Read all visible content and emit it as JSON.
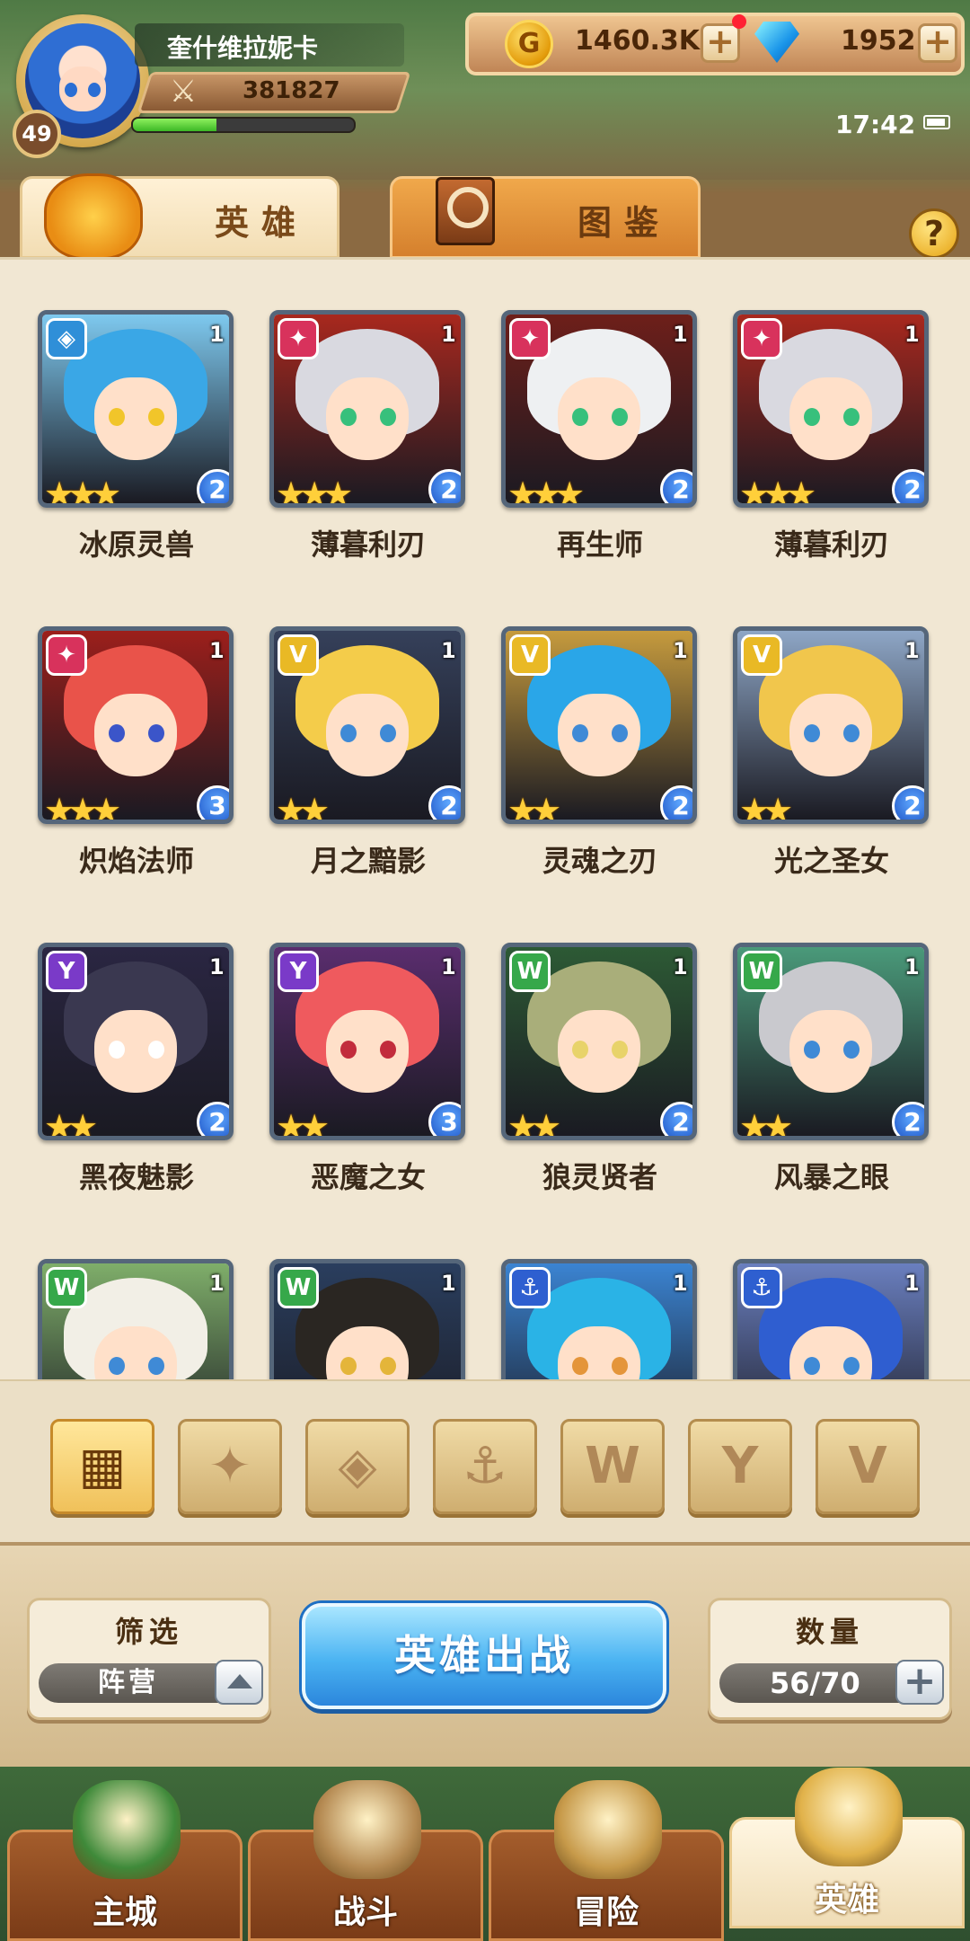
{
  "player": {
    "name": "奎什维拉妮卡",
    "level": "49",
    "power": "381827",
    "exp_fraction": 0.38
  },
  "resources": {
    "gold": "1460.3K",
    "gems": "1952"
  },
  "status": {
    "time": "17:42"
  },
  "tabs": [
    {
      "label": "英雄",
      "active": true
    },
    {
      "label": "图鉴",
      "active": false
    }
  ],
  "help_label": "?",
  "heroes": [
    {
      "name": "冰原灵兽",
      "level": "1",
      "stars": "★★★",
      "rank": "2",
      "faction": "ice",
      "faction_color": "#2f8fd8",
      "faction_glyph": "◈",
      "bg": "#7ec9ef",
      "hair": "#3aa7e6",
      "eye": "#f1c52a"
    },
    {
      "name": "薄暮利刃",
      "level": "1",
      "stars": "★★★",
      "rank": "2",
      "faction": "fire",
      "faction_color": "#d8325c",
      "faction_glyph": "✦",
      "bg": "#a8281e",
      "hair": "#d9d9e0",
      "eye": "#37c07c"
    },
    {
      "name": "再生师",
      "level": "1",
      "stars": "★★★",
      "rank": "2",
      "faction": "fire",
      "faction_color": "#d8325c",
      "faction_glyph": "✦",
      "bg": "#6e1f1a",
      "hair": "#eef0f2",
      "eye": "#37c07c"
    },
    {
      "name": "薄暮利刃",
      "level": "1",
      "stars": "★★★",
      "rank": "2",
      "faction": "fire",
      "faction_color": "#d8325c",
      "faction_glyph": "✦",
      "bg": "#a8281e",
      "hair": "#d9d9e0",
      "eye": "#37c07c"
    },
    {
      "name": "炽焰法师",
      "level": "1",
      "stars": "★★★",
      "rank": "3",
      "faction": "fire",
      "faction_color": "#d8325c",
      "faction_glyph": "✦",
      "bg": "#9c1f1b",
      "hair": "#e9534a",
      "eye": "#3b55c9"
    },
    {
      "name": "月之黯影",
      "level": "1",
      "stars": "★★",
      "rank": "2",
      "faction": "light",
      "faction_color": "#e9b925",
      "faction_glyph": "V",
      "bg": "#35405a",
      "hair": "#f4cc4a",
      "eye": "#3f8ad6"
    },
    {
      "name": "灵魂之刃",
      "level": "1",
      "stars": "★★",
      "rank": "2",
      "faction": "light",
      "faction_color": "#e9b925",
      "faction_glyph": "V",
      "bg": "#c69b3e",
      "hair": "#2aa6e8",
      "eye": "#3f8ad6"
    },
    {
      "name": "光之圣女",
      "level": "1",
      "stars": "★★",
      "rank": "2",
      "faction": "light",
      "faction_color": "#e9b925",
      "faction_glyph": "V",
      "bg": "#8ea6c6",
      "hair": "#f1c64c",
      "eye": "#3f8ad6"
    },
    {
      "name": "黑夜魅影",
      "level": "1",
      "stars": "★★",
      "rank": "2",
      "faction": "dark",
      "faction_color": "#7a3ac8",
      "faction_glyph": "Y",
      "bg": "#2a2642",
      "hair": "#3a3850",
      "eye": "#ffffff"
    },
    {
      "name": "恶魔之女",
      "level": "1",
      "stars": "★★",
      "rank": "3",
      "faction": "dark",
      "faction_color": "#7a3ac8",
      "faction_glyph": "Y",
      "bg": "#5a2d6e",
      "hair": "#ef5a5e",
      "eye": "#c22c3c"
    },
    {
      "name": "狼灵贤者",
      "level": "1",
      "stars": "★★",
      "rank": "2",
      "faction": "beast",
      "faction_color": "#36a84a",
      "faction_glyph": "W",
      "bg": "#2d5a35",
      "hair": "#a9ae7a",
      "eye": "#e8d36a"
    },
    {
      "name": "风暴之眼",
      "level": "1",
      "stars": "★★",
      "rank": "2",
      "faction": "beast",
      "faction_color": "#36a84a",
      "faction_glyph": "W",
      "bg": "#4a9a7a",
      "hair": "#c9c9ce",
      "eye": "#3f8ad6"
    },
    {
      "name": "",
      "level": "1",
      "stars": "",
      "rank": "",
      "faction": "beast",
      "faction_color": "#36a84a",
      "faction_glyph": "W",
      "bg": "#7fae6a",
      "hair": "#f2efe6",
      "eye": "#3f8ad6"
    },
    {
      "name": "",
      "level": "1",
      "stars": "",
      "rank": "",
      "faction": "beast",
      "faction_color": "#36a84a",
      "faction_glyph": "W",
      "bg": "#2a3e5e",
      "hair": "#2a2622",
      "eye": "#e4b53a"
    },
    {
      "name": "",
      "level": "1",
      "stars": "",
      "rank": "",
      "faction": "sea",
      "faction_color": "#2e5fd0",
      "faction_glyph": "⚓",
      "bg": "#3b84d2",
      "hair": "#2ab3e6",
      "eye": "#e4953a"
    },
    {
      "name": "",
      "level": "1",
      "stars": "",
      "rank": "",
      "faction": "sea",
      "faction_color": "#2e5fd0",
      "faction_glyph": "⚓",
      "bg": "#6a7fbf",
      "hair": "#2f5ed0",
      "eye": "#3f8ad6"
    }
  ],
  "faction_filters": [
    {
      "id": "all",
      "icon": "grid-icon",
      "glyph": "▦",
      "active": true
    },
    {
      "id": "fire",
      "icon": "flame-icon",
      "glyph": "✦",
      "active": false
    },
    {
      "id": "ice",
      "icon": "crystal-icon",
      "glyph": "◈",
      "active": false
    },
    {
      "id": "sea",
      "icon": "anchor-icon",
      "glyph": "⚓",
      "active": false
    },
    {
      "id": "beast",
      "icon": "beast-icon",
      "glyph": "W",
      "active": false
    },
    {
      "id": "dark",
      "icon": "horns-icon",
      "glyph": "Y",
      "active": false
    },
    {
      "id": "light",
      "icon": "wings-icon",
      "glyph": "V",
      "active": false
    }
  ],
  "filter_box": {
    "title": "筛选",
    "value": "阵营"
  },
  "deploy_label": "英雄出战",
  "count_box": {
    "title": "数量",
    "value": "56/70"
  },
  "nav": [
    {
      "label": "主城",
      "icon": "castle-icon",
      "active": false
    },
    {
      "label": "战斗",
      "icon": "crossed-swords-icon",
      "active": false
    },
    {
      "label": "冒险",
      "icon": "scroll-map-icon",
      "active": false
    },
    {
      "label": "英雄",
      "icon": "hero-helmet-icon",
      "active": true
    }
  ]
}
